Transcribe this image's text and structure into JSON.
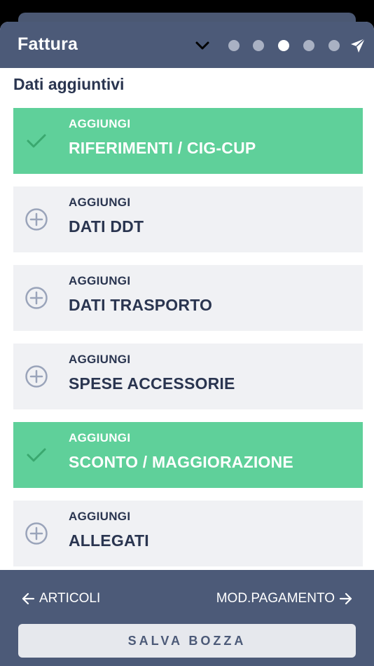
{
  "header": {
    "title": "Fattura",
    "steps": [
      {
        "active": false
      },
      {
        "active": false
      },
      {
        "active": true
      },
      {
        "active": false
      },
      {
        "active": false
      }
    ]
  },
  "section_title": "Dati aggiuntivi",
  "items": [
    {
      "kicker": "AGGIUNGI",
      "label": "RIFERIMENTI / CIG-CUP",
      "done": true,
      "icon": "check-icon"
    },
    {
      "kicker": "AGGIUNGI",
      "label": "DATI DDT",
      "done": false,
      "icon": "plus-circle-icon"
    },
    {
      "kicker": "AGGIUNGI",
      "label": "DATI TRASPORTO",
      "done": false,
      "icon": "plus-circle-icon"
    },
    {
      "kicker": "AGGIUNGI",
      "label": "SPESE ACCESSORIE",
      "done": false,
      "icon": "plus-circle-icon"
    },
    {
      "kicker": "AGGIUNGI",
      "label": "SCONTO / MAGGIORAZIONE",
      "done": true,
      "icon": "check-icon"
    },
    {
      "kicker": "AGGIUNGI",
      "label": "ALLEGATI",
      "done": false,
      "icon": "plus-circle-icon"
    }
  ],
  "footer": {
    "back_label": "ARTICOLI",
    "next_label": "MOD.PAGAMENTO",
    "save_label": "SALVA BOZZA"
  },
  "colors": {
    "header_bg": "#4c5a78",
    "done_bg": "#5fd09a",
    "pending_bg": "#f0f1f4",
    "text_dark": "#2a3550"
  }
}
